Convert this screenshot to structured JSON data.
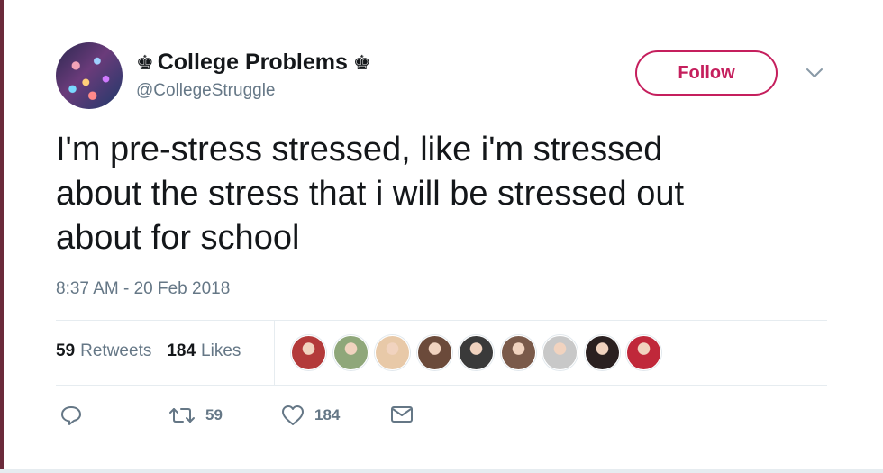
{
  "profile": {
    "display_name": "College Problems",
    "handle": "@CollegeStruggle",
    "crown_glyph": "♚",
    "avatar": "crowd-photo"
  },
  "follow_button": {
    "label": "Follow",
    "color": "#c51f5d"
  },
  "more_menu": {
    "icon": "chevron-down-icon"
  },
  "tweet": {
    "text": "I'm pre-stress stressed, like i'm stressed\nabout the stress that i will be stressed out\nabout for school",
    "timestamp": "8:37 AM - 20 Feb 2018"
  },
  "stats": {
    "retweets_count": "59",
    "retweets_label": "Retweets",
    "likes_count": "184",
    "likes_label": "Likes"
  },
  "likers": [
    {
      "name": "liker-avatar-1",
      "color": "#b33a3a"
    },
    {
      "name": "liker-avatar-2",
      "color": "#8fa77a"
    },
    {
      "name": "liker-avatar-3",
      "color": "#e8c9a8"
    },
    {
      "name": "liker-avatar-4",
      "color": "#6b4a3a"
    },
    {
      "name": "liker-avatar-5",
      "color": "#3a3a3a"
    },
    {
      "name": "liker-avatar-6",
      "color": "#7a5a4a"
    },
    {
      "name": "liker-avatar-7",
      "color": "#c8c8c8"
    },
    {
      "name": "liker-avatar-8",
      "color": "#2a2020"
    },
    {
      "name": "liker-avatar-9",
      "color": "#c0283a"
    }
  ],
  "actions": {
    "reply_icon": "reply-icon",
    "retweet_icon": "retweet-icon",
    "retweet_count": "59",
    "like_icon": "heart-icon",
    "like_count": "184",
    "message_icon": "envelope-icon"
  },
  "colors": {
    "accent": "#c51f5d",
    "text": "#14171a",
    "muted": "#657786",
    "border": "#e6ecf0"
  }
}
